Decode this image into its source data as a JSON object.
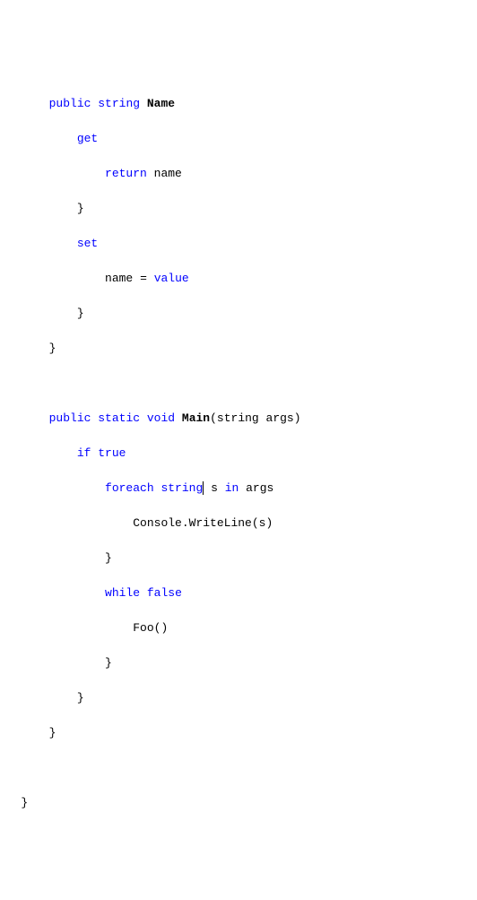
{
  "code": {
    "line1": {
      "public": "public",
      "string": "string",
      "name": "Name"
    },
    "line2": {
      "get": "get"
    },
    "line3": {
      "return": "return",
      "name": "name"
    },
    "line4": {
      "brace": "}"
    },
    "line5": {
      "set": "set"
    },
    "line6": {
      "name": "name",
      "eq": "=",
      "value": "value"
    },
    "line7": {
      "brace": "}"
    },
    "line8": {
      "brace": "}"
    },
    "line10": {
      "public": "public",
      "static": "static",
      "void": "void",
      "main": "Main",
      "params": "(string args)"
    },
    "line11": {
      "if": "if",
      "true": "true"
    },
    "line12": {
      "foreach": "foreach",
      "string": "string",
      "s": "s",
      "in": "in",
      "args": "args"
    },
    "line13": {
      "console": "Console.WriteLine(s)"
    },
    "line14": {
      "brace": "}"
    },
    "line15": {
      "while": "while",
      "false": "false"
    },
    "line16": {
      "foo": "Foo()"
    },
    "line17": {
      "brace": "}"
    },
    "line18": {
      "brace": "}"
    },
    "line19": {
      "brace": "}"
    },
    "line20": {
      "brace": "}"
    }
  }
}
